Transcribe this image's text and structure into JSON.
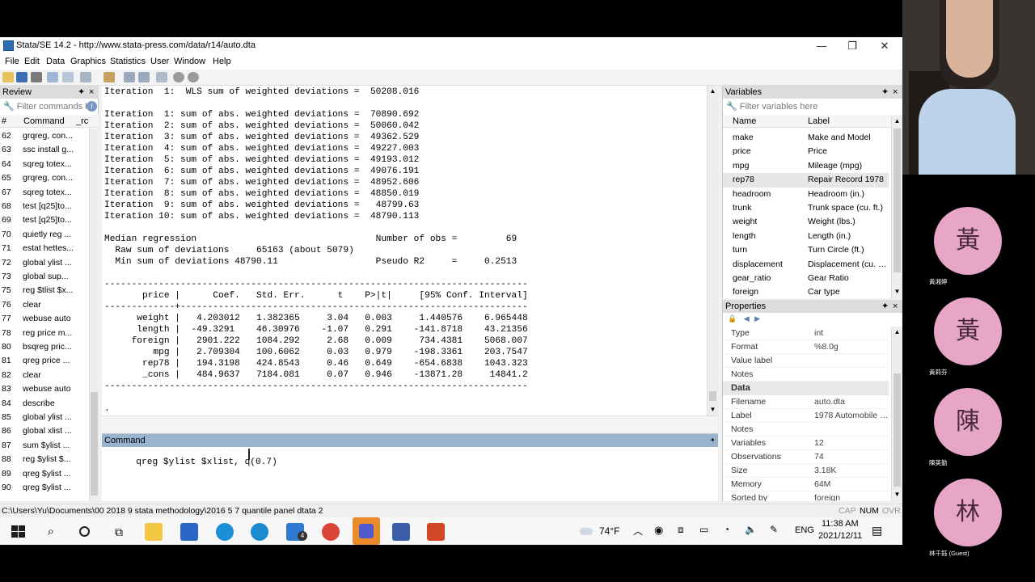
{
  "window": {
    "title": "Stata/SE 14.2 - http://www.stata-press.com/data/r14/auto.dta",
    "minimize": "—",
    "restore": "❐",
    "close": "✕"
  },
  "menu": [
    "File",
    "Edit",
    "Data",
    "Graphics",
    "Statistics",
    "User",
    "Window",
    "Help"
  ],
  "review": {
    "title": "Review",
    "filter_placeholder": "Filter commands h",
    "col_num": "#",
    "col_cmd": "Command",
    "col_rc": "_rc",
    "rows": [
      {
        "n": "62",
        "c": "grqreg, con..."
      },
      {
        "n": "63",
        "c": "ssc install g..."
      },
      {
        "n": "64",
        "c": "sqreg totex..."
      },
      {
        "n": "65",
        "c": "grqreg, con..."
      },
      {
        "n": "67",
        "c": "sqreg totex..."
      },
      {
        "n": "68",
        "c": "test [q25]to..."
      },
      {
        "n": "69",
        "c": "test [q25]to..."
      },
      {
        "n": "70",
        "c": "quietly reg ..."
      },
      {
        "n": "71",
        "c": "estat hettes..."
      },
      {
        "n": "72",
        "c": "global ylist ..."
      },
      {
        "n": "73",
        "c": "global sup..."
      },
      {
        "n": "75",
        "c": "reg $tlist $x..."
      },
      {
        "n": "76",
        "c": "clear"
      },
      {
        "n": "77",
        "c": "webuse auto"
      },
      {
        "n": "78",
        "c": "reg price m..."
      },
      {
        "n": "80",
        "c": "bsqreg pric..."
      },
      {
        "n": "81",
        "c": "qreg price ..."
      },
      {
        "n": "82",
        "c": "clear"
      },
      {
        "n": "83",
        "c": "webuse auto"
      },
      {
        "n": "84",
        "c": "describe"
      },
      {
        "n": "85",
        "c": "global ylist ..."
      },
      {
        "n": "86",
        "c": "global xlist ..."
      },
      {
        "n": "87",
        "c": "sum $ylist ..."
      },
      {
        "n": "88",
        "c": "reg $ylist $..."
      },
      {
        "n": "89",
        "c": "qreg $ylist ..."
      },
      {
        "n": "90",
        "c": "qreg $ylist ..."
      }
    ]
  },
  "results": {
    "lines": [
      "Iteration  1:  WLS sum of weighted deviations =  50208.016",
      "",
      "Iteration  1: sum of abs. weighted deviations =  70890.692",
      "Iteration  2: sum of abs. weighted deviations =  50060.042",
      "Iteration  3: sum of abs. weighted deviations =  49362.529",
      "Iteration  4: sum of abs. weighted deviations =  49227.003",
      "Iteration  5: sum of abs. weighted deviations =  49193.012",
      "Iteration  6: sum of abs. weighted deviations =  49076.191",
      "Iteration  7: sum of abs. weighted deviations =  48952.606",
      "Iteration  8: sum of abs. weighted deviations =  48850.019",
      "Iteration  9: sum of abs. weighted deviations =   48799.63",
      "Iteration 10: sum of abs. weighted deviations =  48790.113",
      "",
      "Median regression                                 Number of obs =         69",
      "  Raw sum of deviations     65163 (about 5079)",
      "  Min sum of deviations 48790.11                  Pseudo R2     =     0.2513",
      "",
      "------------------------------------------------------------------------------",
      "       price |      Coef.   Std. Err.      t    P>|t|     [95% Conf. Interval]",
      "-------------+----------------------------------------------------------------",
      "      weight |   4.203012   1.382365     3.04   0.003     1.440576    6.965448",
      "      length |  -49.3291    46.30976    -1.07   0.291    -141.8718    43.21356",
      "     foreign |   2901.222   1084.292     2.68   0.009     734.4381    5068.007",
      "         mpg |   2.709304   100.6062     0.03   0.979    -198.3361    203.7547",
      "       rep78 |   194.3198   424.8543     0.46   0.649    -654.6838    1043.323",
      "       _cons |   484.9637   7184.081     0.07   0.946    -13871.28     14841.2",
      "------------------------------------------------------------------------------",
      "",
      "."
    ]
  },
  "command": {
    "title": "Command",
    "text": "qreg $ylist $xlist, q(0.7)"
  },
  "variables": {
    "title": "Variables",
    "filter_placeholder": "Filter variables here",
    "col_name": "Name",
    "col_label": "Label",
    "rows": [
      {
        "n": "make",
        "l": "Make and Model"
      },
      {
        "n": "price",
        "l": "Price"
      },
      {
        "n": "mpg",
        "l": "Mileage (mpg)"
      },
      {
        "n": "rep78",
        "l": "Repair Record 1978"
      },
      {
        "n": "headroom",
        "l": "Headroom (in.)"
      },
      {
        "n": "trunk",
        "l": "Trunk space (cu. ft.)"
      },
      {
        "n": "weight",
        "l": "Weight (lbs.)"
      },
      {
        "n": "length",
        "l": "Length (in.)"
      },
      {
        "n": "turn",
        "l": "Turn Circle (ft.)"
      },
      {
        "n": "displacement",
        "l": "Displacement (cu. i..."
      },
      {
        "n": "gear_ratio",
        "l": "Gear Ratio"
      },
      {
        "n": "foreign",
        "l": "Car type"
      }
    ]
  },
  "properties": {
    "title": "Properties",
    "var_rows": [
      {
        "k": "Type",
        "v": "int"
      },
      {
        "k": "Format",
        "v": "%8.0g"
      },
      {
        "k": "Value label",
        "v": ""
      },
      {
        "k": "Notes",
        "v": ""
      }
    ],
    "data_section": "Data",
    "data_rows": [
      {
        "k": "Filename",
        "v": "auto.dta"
      },
      {
        "k": "Label",
        "v": "1978 Automobile Da..."
      },
      {
        "k": "Notes",
        "v": ""
      },
      {
        "k": "Variables",
        "v": "12"
      },
      {
        "k": "Observations",
        "v": "74"
      },
      {
        "k": "Size",
        "v": "3.18K"
      },
      {
        "k": "Memory",
        "v": "64M"
      },
      {
        "k": "Sorted by",
        "v": "foreign"
      }
    ]
  },
  "status": {
    "path": "C:\\Users\\Yu\\Documents\\00 2018 9 stata methodology\\2016 5 7 quantile panel dtata 2",
    "cap": "CAP",
    "num": "NUM",
    "ovr": "OVR"
  },
  "taskbar": {
    "weather": "74°F",
    "lang": "ENG",
    "time": "11:38 AM",
    "date": "2021/12/11",
    "mail_badge": "4"
  },
  "participants": [
    {
      "char": "黃",
      "name": "黃湘婷"
    },
    {
      "char": "黃",
      "name": "黃莉芬"
    },
    {
      "char": "陳",
      "name": "陳英勤"
    },
    {
      "char": "林",
      "name": "林千鈺 (Guest)"
    }
  ],
  "colors": {
    "accent": "#99b4d1",
    "avatar": "#e8a6c7"
  }
}
